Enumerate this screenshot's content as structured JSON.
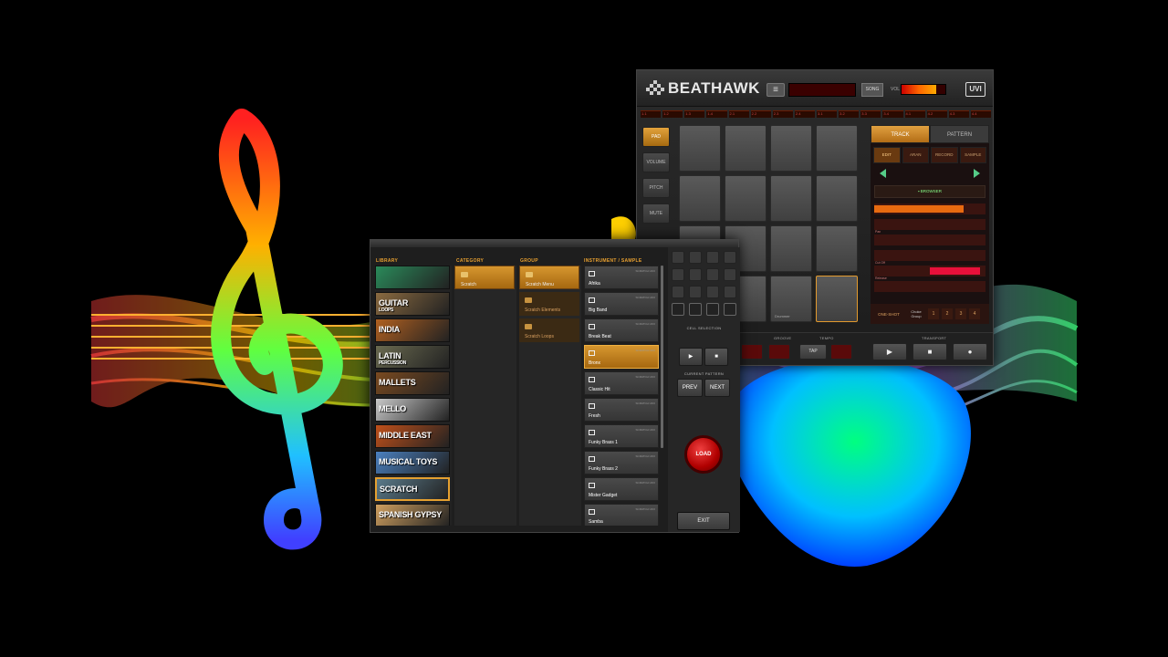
{
  "main": {
    "app_name": "BEATHAWK",
    "vendor_logo": "UVI",
    "menu_icon": "≡",
    "lcd_text": "",
    "song_label": "SONG",
    "vol_label": "VOL",
    "vol_level": 0.8,
    "steps": [
      "1.1",
      "1.2",
      "1.3",
      "1.4",
      "2.1",
      "2.2",
      "2.3",
      "2.4",
      "3.1",
      "3.2",
      "3.3",
      "3.4",
      "4.1",
      "4.2",
      "4.3",
      "4.4"
    ],
    "side_buttons": [
      "PAD",
      "VOLUME",
      "PITCH",
      "MUTE"
    ],
    "pad_labels": [
      "",
      "",
      "",
      "",
      "",
      "",
      "",
      "",
      "",
      "",
      "",
      "",
      "",
      "Bass",
      "Drummer",
      ""
    ],
    "tabs": [
      "TRACK",
      "PATTERN"
    ],
    "subtabs": [
      "EDIT",
      "ARAN",
      "RECORD",
      "SAMPLE"
    ],
    "browser_label": "BROWSER",
    "params": [
      {
        "name": "",
        "fill": 0.8
      },
      {
        "name": "",
        "fill": 0.0
      },
      {
        "name": "Pan",
        "fill": 0.0
      },
      {
        "name": "",
        "fill": 0.0
      },
      {
        "name": "Cut Off",
        "fill": 0.45
      },
      {
        "name": "Release",
        "fill": 0.0
      }
    ],
    "oneshot_label": "ONE-SHOT",
    "choke_label": "Choke Group",
    "choke_numbers": [
      "1",
      "2",
      "3",
      "4"
    ],
    "groove_label": "GROOVE",
    "tempo_label": "TEMPO",
    "tap_label": "TAP",
    "transport_label": "TRANSPORT",
    "transport_buttons": [
      "▶",
      "■",
      "●"
    ]
  },
  "library": {
    "col_titles": [
      "LIBRARY",
      "CATEGORY",
      "GROUP",
      "INSTRUMENT / SAMPLE"
    ],
    "library_items": [
      {
        "label": "",
        "color": "#2a8a5a"
      },
      {
        "label": "GUITAR",
        "sub": "LOOPS",
        "color": "#8a6a40"
      },
      {
        "label": "INDIA",
        "color": "#b06020"
      },
      {
        "label": "LATIN",
        "sub": "PERCUSSION",
        "color": "#6a6a50"
      },
      {
        "label": "MALLETS",
        "color": "#7a4a20"
      },
      {
        "label": "MELLO",
        "color": "#c8c8c8"
      },
      {
        "label": "MIDDLE EAST",
        "color": "#c0501a"
      },
      {
        "label": "MUSICAL TOYS",
        "color": "#4a80c0"
      },
      {
        "label": "SCRATCH",
        "color": "#5a7a8a"
      },
      {
        "label": "SPANISH GYPSY",
        "color": "#d0a060"
      }
    ],
    "category_items": [
      "Scratch"
    ],
    "group_items": [
      "Scratch Menu",
      "Scratch Elements",
      "Scratch Loops"
    ],
    "instrument_tag": "SCRATCH UFO",
    "instruments": [
      "Afrika",
      "Big Band",
      "Break Beat",
      "Bronx",
      "Classic Hit",
      "Fresh",
      "Funky Brass 1",
      "Funky Brass 2",
      "Mister Gadget",
      "Samba"
    ],
    "selected_instrument": "Bronx",
    "cell_selection_label": "CELL SELECTION",
    "play_icon": "▶",
    "stop_icon": "■",
    "current_pattern_label": "CURRENT PATTERN",
    "prev_label": "PREV",
    "next_label": "NEXT",
    "load_label": "LOAD",
    "exit_label": "EXIT"
  }
}
